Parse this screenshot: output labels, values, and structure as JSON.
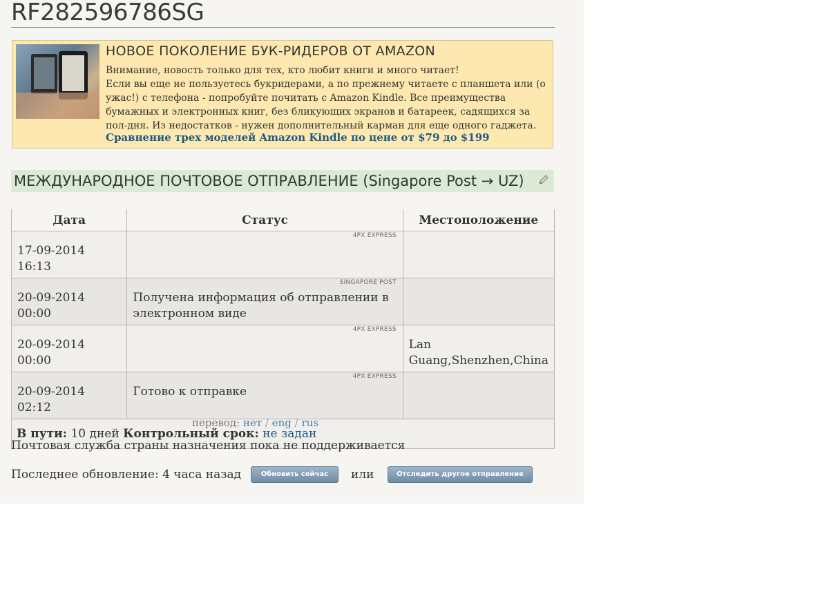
{
  "tracking_number": "RF282596786SG",
  "ad": {
    "heading": "НОВОЕ ПОКОЛЕНИЕ БУК-РИДЕРОВ ОТ AMAZON",
    "line1": "Внимание, новость только для тех, кто любит книги и много читает!",
    "line2": "Если вы еще не пользуетесь букридерами, а по прежнему читаете с планшета или (о ужас!) с телефона - попробуйте почитать с Amazon Kindle. Все преимущества бумажных и электронных книг, без бликующих экранов и батареек, садящихся за пол-дня. Из недостатков - нужен дополнительный карман для еще одного гаджета.",
    "link": "Сравнение трех моделей Amazon Kindle по цене от $79 до $199"
  },
  "section": {
    "title": "МЕЖДУНАРОДНОЕ ПОЧТОВОЕ ОТПРАВЛЕНИЕ",
    "route": "(Singapore Post → UZ)"
  },
  "table": {
    "headers": {
      "date": "Дата",
      "status": "Статус",
      "location": "Местоположение"
    },
    "rows": [
      {
        "date": "17-09-2014 16:13",
        "carrier": "4PX EXPRESS",
        "status": "",
        "location": ""
      },
      {
        "date": "20-09-2014 00:00",
        "carrier": "SINGAPORE POST",
        "status": "Получена информация об отправлении в электронном виде",
        "location": ""
      },
      {
        "date": "20-09-2014 00:00",
        "carrier": "4PX EXPRESS",
        "status": "",
        "location": "Lan Guang,Shenzhen,China"
      },
      {
        "date": "20-09-2014 02:12",
        "carrier": "4PX EXPRESS",
        "status": "Готово к отправке",
        "location": ""
      }
    ],
    "summary": {
      "in_transit_label": "В пути:",
      "in_transit_value": "10 дней",
      "deadline_label": "Контрольный срок:",
      "deadline_value": "не задан"
    }
  },
  "translate": {
    "label": "перевод:",
    "options": [
      "нет",
      "eng",
      "rus"
    ]
  },
  "notice": "Почтовая служба страны назначения пока не поддерживается",
  "update": {
    "label": "Последнее обновление: 4 часа назад",
    "refresh_button": "Обновить сейчас",
    "or": "или",
    "track_other_button": "Отследить другое отправление"
  },
  "icons": {
    "edit": "pencil-icon"
  }
}
